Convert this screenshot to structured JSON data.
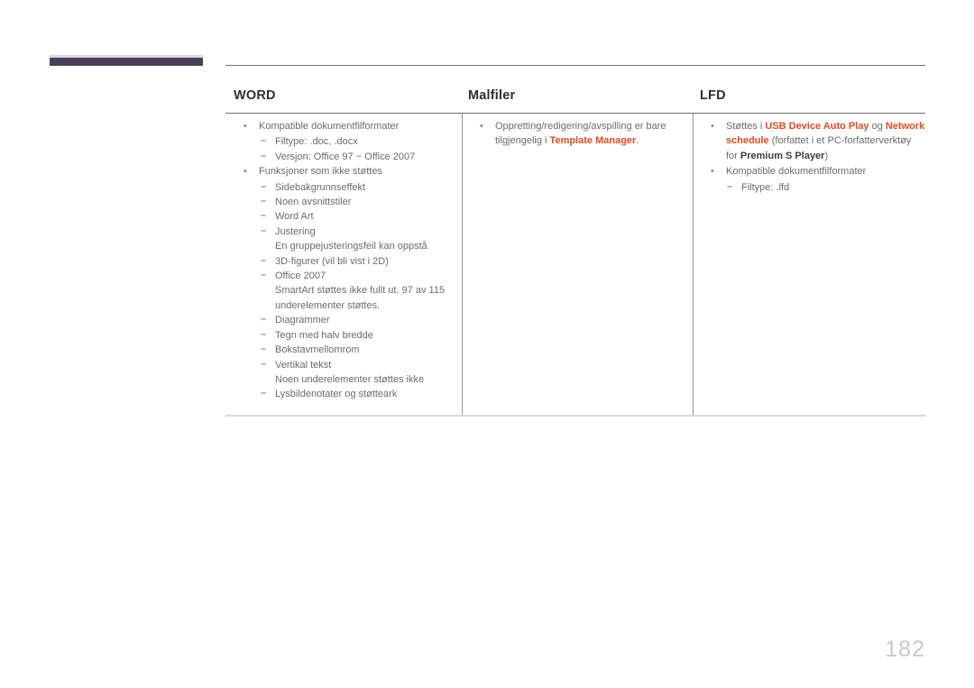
{
  "page": {
    "number": "182"
  },
  "decor": {
    "chapter_bar_color": "#4a4055",
    "chapter_bar_top_color": "#d8d5e0"
  },
  "colors": {
    "accent": "#e04e26",
    "body_text": "#6b6b6b",
    "heading_text": "#2f2f2f",
    "rule": "#75737a",
    "page_number": "#c9c9cd"
  },
  "table": {
    "headers": [
      {
        "label": "WORD"
      },
      {
        "label": "Malfiler"
      },
      {
        "label": "LFD"
      }
    ],
    "columns": [
      {
        "name": "word",
        "items": [
          {
            "level": 1,
            "marker": "•",
            "text": "Kompatible dokumentfilformater"
          },
          {
            "level": 2,
            "marker": "–",
            "text": "Filtype: .doc, .docx"
          },
          {
            "level": 2,
            "marker": "–",
            "text": "Versjon: Office 97 ~ Office 2007"
          },
          {
            "level": 1,
            "marker": "•",
            "text": "Funksjoner som ikke støttes"
          },
          {
            "level": 2,
            "marker": "–",
            "text": "Sidebakgrunnseffekt"
          },
          {
            "level": 2,
            "marker": "–",
            "text": "Noen avsnittstiler"
          },
          {
            "level": 2,
            "marker": "–",
            "text": "Word Art"
          },
          {
            "level": 2,
            "marker": "–",
            "text": "Justering"
          },
          {
            "level": 3,
            "marker": "",
            "text": "En gruppejusteringsfeil kan oppstå"
          },
          {
            "level": 2,
            "marker": "–",
            "text": "3D-figurer (vil bli vist i 2D)"
          },
          {
            "level": 2,
            "marker": "–",
            "text": "Office 2007"
          },
          {
            "level": 3,
            "marker": "",
            "text": "SmartArt støttes ikke fullt ut. 97 av 115 underelementer støttes."
          },
          {
            "level": 2,
            "marker": "–",
            "text": "Diagrammer"
          },
          {
            "level": 2,
            "marker": "–",
            "text": "Tegn med halv bredde"
          },
          {
            "level": 2,
            "marker": "–",
            "text": "Bokstavmellomrom"
          },
          {
            "level": 2,
            "marker": "–",
            "text": "Vertikal tekst"
          },
          {
            "level": 3,
            "marker": "",
            "text": "Noen underelementer støttes ikke"
          },
          {
            "level": 2,
            "marker": "–",
            "text": "Lysbildenotater og støtteark"
          }
        ]
      },
      {
        "name": "malfiler",
        "items": [
          {
            "level": 1,
            "marker": "•",
            "parts": [
              {
                "text": "Oppretting/redigering/avspilling er bare tilgjengelig i ",
                "style": "normal"
              },
              {
                "text": "Template Manager",
                "style": "accent"
              },
              {
                "text": ".",
                "style": "normal"
              }
            ]
          }
        ]
      },
      {
        "name": "lfd",
        "items": [
          {
            "level": 1,
            "marker": "•",
            "parts": [
              {
                "text": "Støttes i ",
                "style": "normal"
              },
              {
                "text": "USB Device Auto Play",
                "style": "accent"
              },
              {
                "text": " og ",
                "style": "normal"
              },
              {
                "text": "Network schedule",
                "style": "accent"
              },
              {
                "text": " (forfattet i et PC-forfatterverktøy for ",
                "style": "normal"
              },
              {
                "text": "Premium S Player",
                "style": "strong"
              },
              {
                "text": ")",
                "style": "normal"
              }
            ]
          },
          {
            "level": 1,
            "marker": "•",
            "text": "Kompatible dokumentfilformater"
          },
          {
            "level": 2,
            "marker": "–",
            "text": "Filtype: .lfd"
          }
        ]
      }
    ]
  }
}
